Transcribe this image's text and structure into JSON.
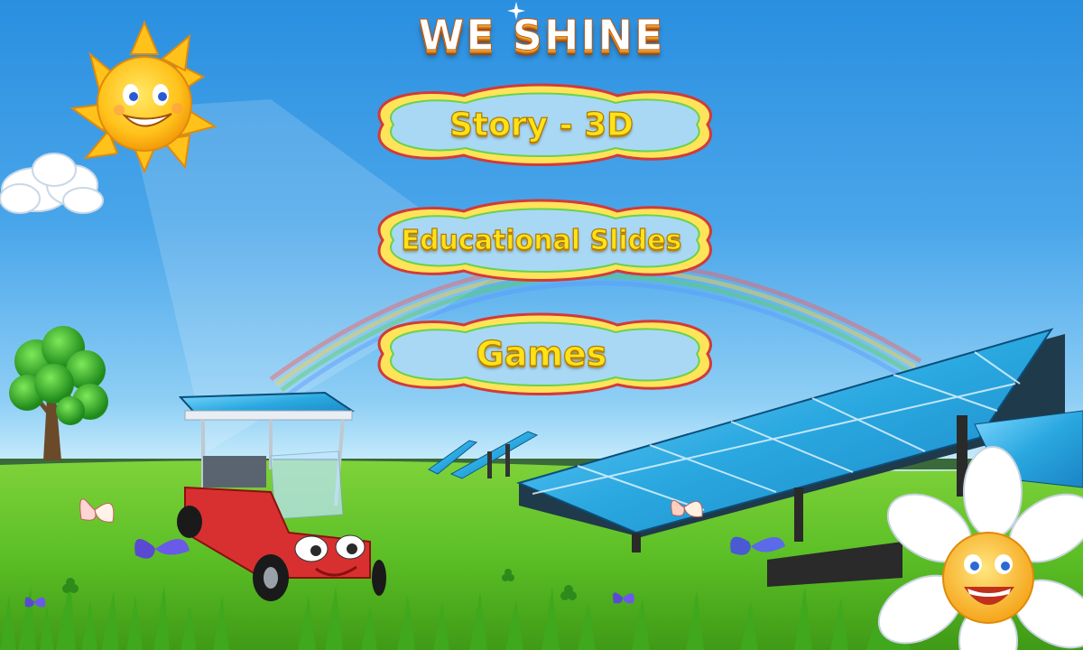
{
  "app": {
    "title": "WE SHINE"
  },
  "menu": {
    "story_label": "Story - 3D",
    "slides_label": "Educational Slides",
    "games_label": "Games"
  },
  "colors": {
    "sky_top": "#2a8fe0",
    "grass": "#5cc02a",
    "button_fill": "#a9d8f5",
    "label_yellow": "#ffe21a",
    "panel_blue": "#2aa8e0"
  },
  "icons": {
    "sun": "sun-character-icon",
    "cart": "solar-golf-cart-icon",
    "flower": "daisy-flower-icon",
    "butterflies": "butterfly-icon"
  }
}
